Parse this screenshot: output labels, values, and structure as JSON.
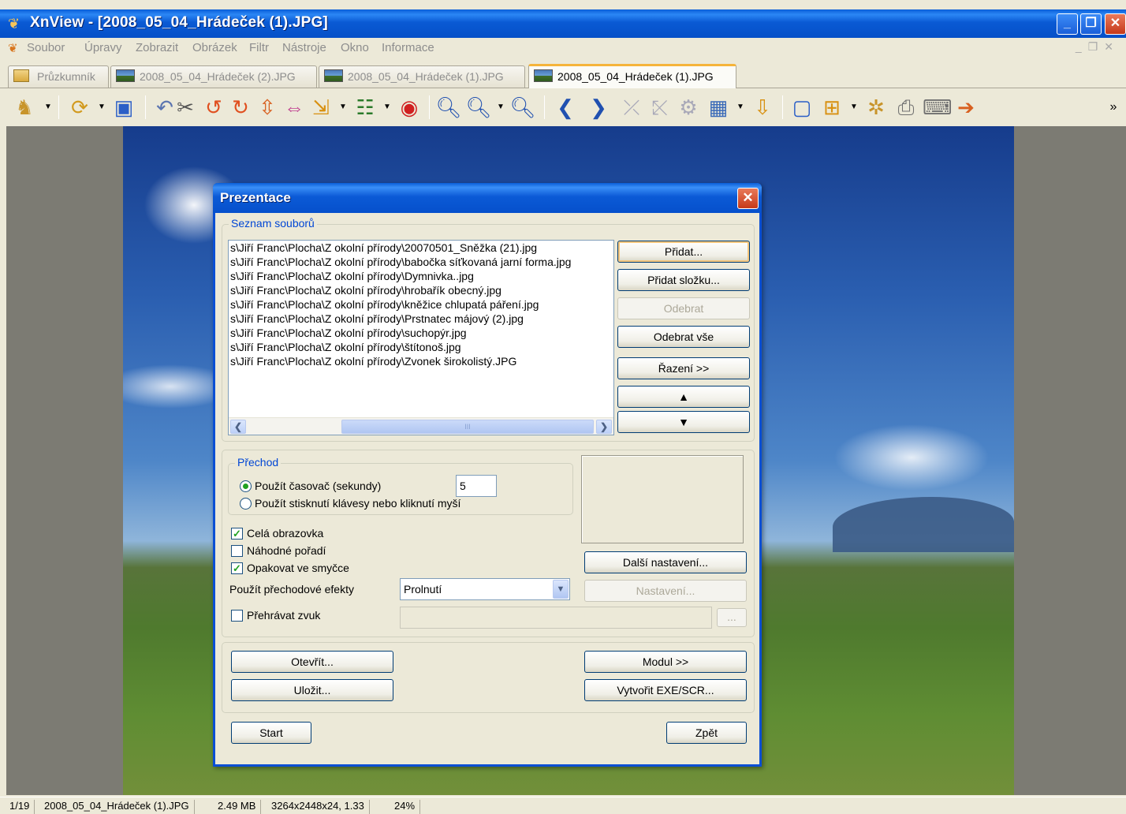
{
  "app": {
    "title": "XnView - [2008_05_04_Hrádeček (1).JPG]",
    "window_buttons": {
      "minimize": "_",
      "restore": "❐",
      "close": "✕"
    }
  },
  "menu": [
    "Soubor",
    "Úpravy",
    "Zobrazit",
    "Obrázek",
    "Filtr",
    "Nástroje",
    "Okno",
    "Informace"
  ],
  "tabs": [
    {
      "label": "Průzkumník",
      "icon": "folder-icon"
    },
    {
      "label": "2008_05_04_Hrádeček (2).JPG",
      "icon": "image-icon"
    },
    {
      "label": "2008_05_04_Hrádeček (1).JPG",
      "icon": "image-icon"
    },
    {
      "label": "2008_05_04_Hrádeček (1).JPG",
      "icon": "image-icon",
      "active": true
    }
  ],
  "toolbar": {
    "overflow": "»"
  },
  "dialog": {
    "title": "Prezentace",
    "files_group": "Seznam souborů",
    "files": [
      "s\\Jiří Franc\\Plocha\\Z okolní přírody\\20070501_Sněžka (21).jpg",
      "s\\Jiří Franc\\Plocha\\Z okolní přírody\\babočka síťkovaná jarní forma.jpg",
      "s\\Jiří Franc\\Plocha\\Z okolní přírody\\Dymnivka..jpg",
      "s\\Jiří Franc\\Plocha\\Z okolní přírody\\hrobařík obecný.jpg",
      "s\\Jiří Franc\\Plocha\\Z okolní přírody\\kněžice chlupatá páření.jpg",
      "s\\Jiří Franc\\Plocha\\Z okolní přírody\\Prstnatec májový (2).jpg",
      "s\\Jiří Franc\\Plocha\\Z okolní přírody\\suchopýr.jpg",
      "s\\Jiří Franc\\Plocha\\Z okolní přírody\\štítonoš.jpg",
      "s\\Jiří Franc\\Plocha\\Z okolní přírody\\Zvonek širokolistý.JPG"
    ],
    "buttons": {
      "add": "Přidat...",
      "add_folder": "Přidat složku...",
      "remove": "Odebrat",
      "remove_all": "Odebrat vše",
      "sort": "Řazení >>",
      "up": "▲",
      "down": "▼",
      "more_settings": "Další nastavení...",
      "settings": "Nastavení...",
      "browse": "...",
      "open": "Otevřít...",
      "save": "Uložit...",
      "module": "Modul >>",
      "create_exe": "Vytvořit EXE/SCR...",
      "start": "Start",
      "back": "Zpět"
    },
    "transition_group": "Přechod",
    "timer_label": "Použít časovač (sekundy)",
    "timer_value": "5",
    "key_label": "Použít stisknutí klávesy nebo kliknutí myší",
    "fullscreen_label": "Celá obrazovka",
    "fullscreen_checked": true,
    "random_label": "Náhodné pořadí",
    "random_checked": false,
    "loop_label": "Opakovat ve smyčce",
    "loop_checked": true,
    "effects_label": "Použít přechodové efekty",
    "effects_value": "Prolnutí",
    "sound_label": "Přehrávat zvuk",
    "sound_checked": false,
    "scroll_thumb": "III"
  },
  "status": {
    "index": "1/19",
    "filename": "2008_05_04_Hrádeček (1).JPG",
    "size": "2.49 MB",
    "dims": "3264x2448x24, 1.33",
    "zoom": "24%"
  }
}
